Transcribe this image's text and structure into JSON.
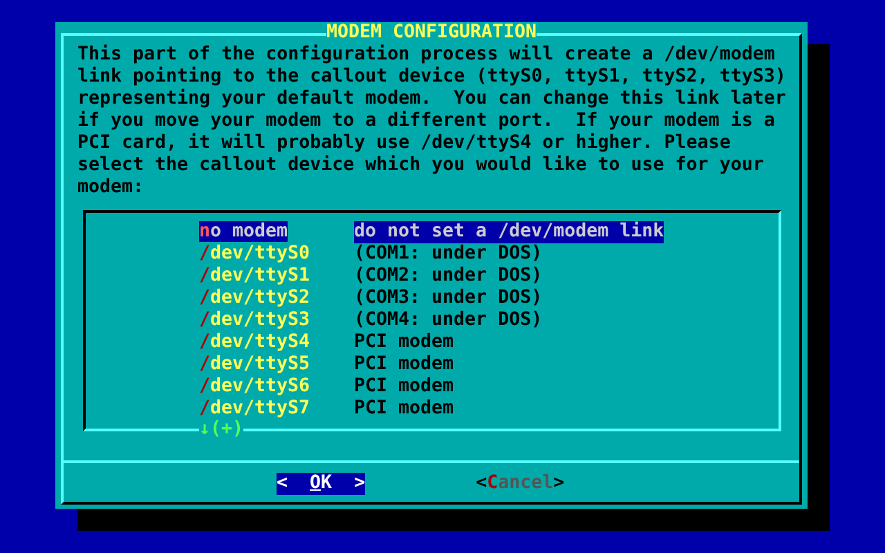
{
  "dialog": {
    "title": "MODEM CONFIGURATION",
    "message": "This part of the configuration process will create a /dev/modem\nlink pointing to the callout device (ttyS0, ttyS1, ttyS2, ttyS3)\nrepresenting your default modem.  You can change this link later\nif you move your modem to a different port.  If your modem is a\nPCI card, it will probably use /dev/ttyS4 or higher. Please\nselect the callout device which you would like to use for your\nmodem:"
  },
  "menu": {
    "items": [
      {
        "name": "no modem",
        "description": "do not set a /dev/modem link",
        "selected": true
      },
      {
        "name": "/dev/ttyS0",
        "description": "(COM1: under DOS)",
        "selected": false
      },
      {
        "name": "/dev/ttyS1",
        "description": "(COM2: under DOS)",
        "selected": false
      },
      {
        "name": "/dev/ttyS2",
        "description": "(COM3: under DOS)",
        "selected": false
      },
      {
        "name": "/dev/ttyS3",
        "description": "(COM4: under DOS)",
        "selected": false
      },
      {
        "name": "/dev/ttyS4",
        "description": "PCI modem",
        "selected": false
      },
      {
        "name": "/dev/ttyS5",
        "description": "PCI modem",
        "selected": false
      },
      {
        "name": "/dev/ttyS6",
        "description": "PCI modem",
        "selected": false
      },
      {
        "name": "/dev/ttyS7",
        "description": "PCI modem",
        "selected": false
      }
    ],
    "scroll_indicator": "↓(+)"
  },
  "buttons": [
    {
      "label": "<  OK  >",
      "selected": true
    },
    {
      "label": "<Cancel>",
      "selected": false
    }
  ]
}
